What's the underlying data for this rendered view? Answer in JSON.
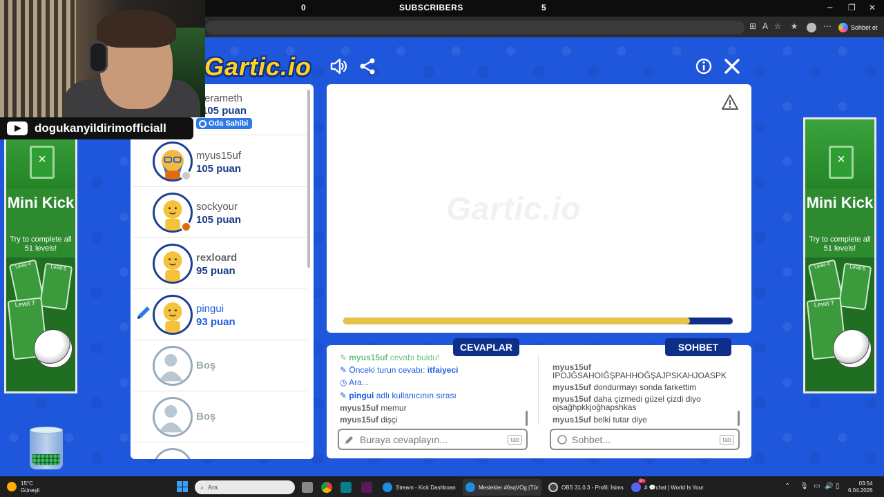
{
  "obs_bar": {
    "left_count": "0",
    "label": "SUBSCRIBERS",
    "right_count": "5"
  },
  "window_controls": {
    "minimize": "─",
    "restore": "❐",
    "close": "✕"
  },
  "browser": {
    "copilot_label": "Sohbet et"
  },
  "webcam": {
    "channel": "dogukanyildirimofficiall"
  },
  "game": {
    "logo": "Gartic.io",
    "canvas_watermark": "Gartic.io",
    "progress_fraction": 0.89,
    "players": [
      {
        "name": "erameth",
        "score": "105 puan",
        "badge": "Oda Sahibi",
        "status_color": ""
      },
      {
        "name": "myus15uf",
        "score": "105 puan",
        "status_color": "#c9c9c9"
      },
      {
        "name": "sockyour",
        "score": "105 puan",
        "status_color": "#e06b10"
      },
      {
        "name": "rexloard",
        "score": "95 puan",
        "status_color": ""
      },
      {
        "name": "pingui",
        "score": "93 puan",
        "status_color": ""
      },
      {
        "name": "Boş",
        "score": ""
      },
      {
        "name": "Boş",
        "score": ""
      }
    ],
    "answers_title": "CEVAPLAR",
    "chat_title": "SOHBET",
    "answers": {
      "m0_user": "myus15uf",
      "m0_text": " cevabı buldu!",
      "m1_text": "Önceki turun cevabı: ",
      "m1_answer": "itfaiyeci",
      "m2_text": "Ara...",
      "m3_user": "pingui",
      "m3_text": " adlı kullanıcının sırası",
      "m4_user": "myus15uf",
      "m4_text": " memur",
      "m5_user": "myus15uf",
      "m5_text": " dişçi"
    },
    "chat": {
      "c1_user": "myus15uf",
      "c1_text": "IPOJĞSAHOIĞŞPAHHOĞŞAJPSKAHJOASPK",
      "c2_user": "myus15uf",
      "c2_text": " dondurmayı sonda farkettim",
      "c3_user": "myus15uf",
      "c3_text": " daha çizmedi güzel çizdi diyo",
      "c3_text2": "ojsağhpkkjoğhapshkas",
      "c4_user": "myus15uf",
      "c4_text": " belki tutar diye"
    },
    "answer_placeholder": "Buraya cevaplayın...",
    "chat_placeholder": "Sohbet...",
    "tab_key": "tab"
  },
  "ad": {
    "title": "Mini Kick",
    "subtitle": "Try to complete all 51 levels!",
    "card_a": "Level 4",
    "card_b": "Level 6",
    "card_c": "Level 7"
  },
  "taskbar": {
    "temp": "15°C",
    "weather": "Güneşli",
    "search": "Ara",
    "apps": [
      {
        "label": "Stream - Kick Dashboan",
        "color": "#1a8fe0"
      },
      {
        "label": "Meslekler #6sqVOg (Tür",
        "color": "#1a8fe0"
      },
      {
        "label": "OBS 31.0.3 - Profil: İsims",
        "color": "#444"
      },
      {
        "label": "# 💬chat | World Is Your",
        "color": "#5865f2"
      }
    ],
    "discord_badge": "9+",
    "time": "03:54",
    "date": "6.04.2026"
  },
  "colors": {
    "accent": "#1e56dc",
    "header": "#0d2f8a",
    "progress": "#e7c24a"
  }
}
